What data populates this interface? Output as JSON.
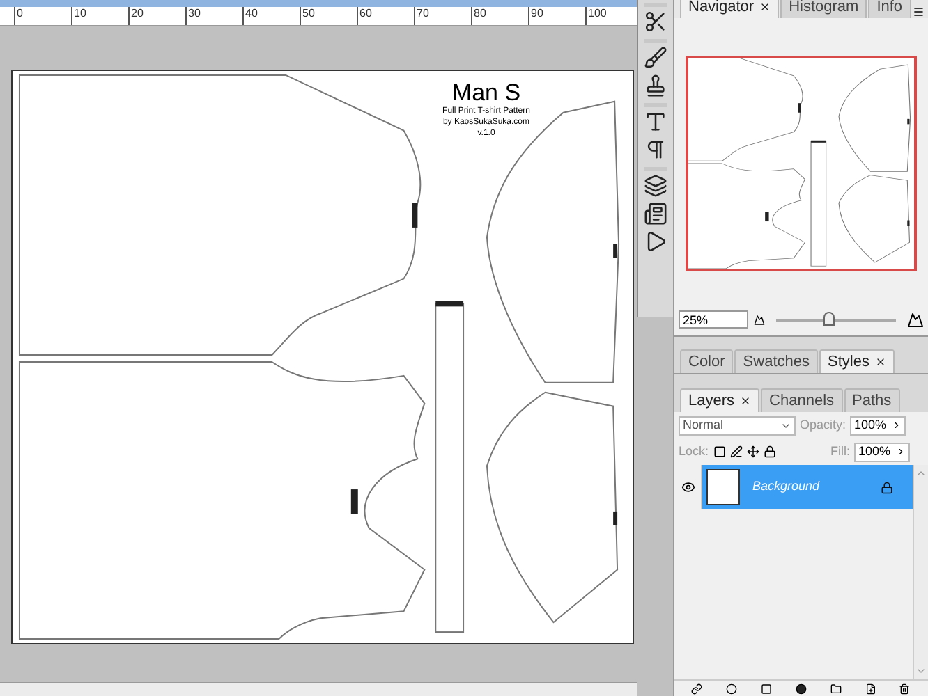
{
  "ruler": {
    "labels": [
      "0",
      "10",
      "20",
      "30",
      "40",
      "50",
      "60",
      "70",
      "80",
      "90",
      "100"
    ]
  },
  "document": {
    "title": "Man S",
    "lines": [
      "Full Print T-shirt Pattern",
      "by KaosSukaSuka.com",
      "v.1.0"
    ]
  },
  "navigator_panel": {
    "tabs": [
      {
        "label": "Navigator",
        "selected": true
      },
      {
        "label": "Histogram",
        "selected": false
      },
      {
        "label": "Info",
        "selected": false
      }
    ],
    "zoom": "25%",
    "level": 0.45
  },
  "color_panel": {
    "tabs": [
      {
        "label": "Color",
        "selected": false
      },
      {
        "label": "Swatches",
        "selected": false
      },
      {
        "label": "Styles",
        "selected": true
      }
    ]
  },
  "layers_panel": {
    "tabs": [
      {
        "label": "Layers",
        "selected": true
      },
      {
        "label": "Channels",
        "selected": false
      },
      {
        "label": "Paths",
        "selected": false
      }
    ],
    "blend_mode": "Normal",
    "opacity_label": "Opacity:",
    "opacity": "100%",
    "lock_label": "Lock:",
    "fill_label": "Fill:",
    "fill": "100%",
    "layers": [
      {
        "name": "Background",
        "selected": true,
        "visible": true,
        "locked": true
      }
    ]
  }
}
